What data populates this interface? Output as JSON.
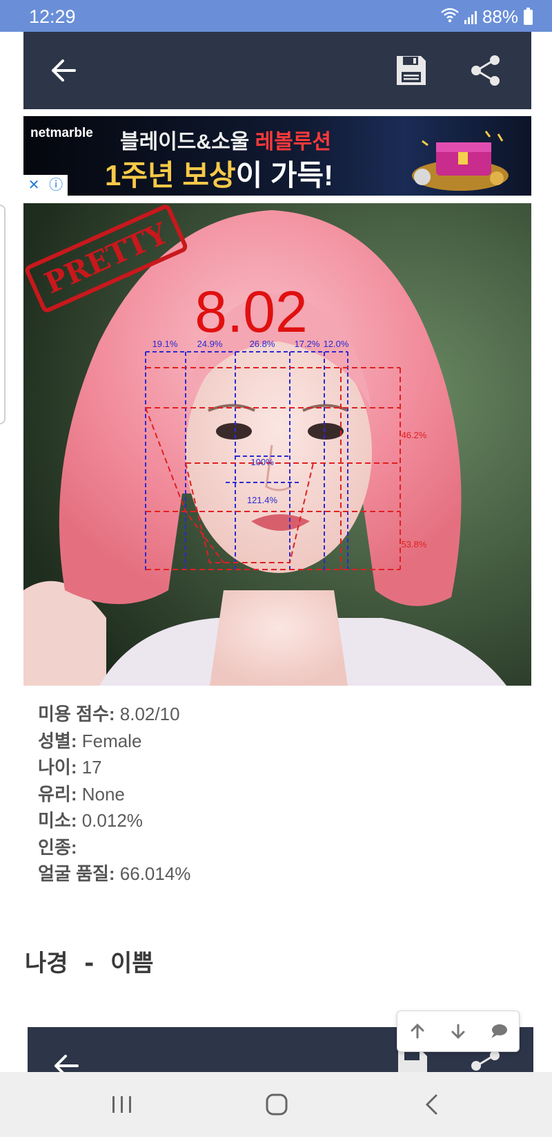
{
  "status": {
    "time": "12:29",
    "battery": "88%"
  },
  "toolbar": {
    "back": "arrow-left-icon",
    "save": "save-icon",
    "share": "share-icon"
  },
  "ad": {
    "brand": "netmarble",
    "line1_a": "블레이드&소울 ",
    "line1_b": "레볼루션",
    "line2_a": "1주년 ",
    "line2_b": "보상",
    "line2_c": "이 가득!",
    "close": "✕",
    "info": "ⓘ"
  },
  "analysis": {
    "stamp": "PRETTY",
    "score": "8.02",
    "width_ratios": [
      "19.1%",
      "24.9%",
      "26.8%",
      "17.2%",
      "12.0%"
    ],
    "nose_width": "100%",
    "mouth_width": "121.4%",
    "upper_ratio": "46.2%",
    "lower_ratio": "53.8%"
  },
  "info": [
    {
      "key": "미용 점수:",
      "value": " 8.02/10"
    },
    {
      "key": "성별:",
      "value": " Female"
    },
    {
      "key": "나이:",
      "value": " 17"
    },
    {
      "key": "유리:",
      "value": " None"
    },
    {
      "key": "미소:",
      "value": " 0.012%"
    },
    {
      "key": "인종:",
      "value": ""
    },
    {
      "key": "얼굴 품질:",
      "value": " 66.014%"
    }
  ],
  "title": "나경 - 이쁨",
  "floating": {
    "up": "arrow-up-icon",
    "down": "arrow-down-icon",
    "comment": "comment-icon"
  },
  "colors": {
    "statusbar": "#6a8fd8",
    "toolbar": "#2d3548",
    "score": "#e01010",
    "guides_red": "#e02020",
    "guides_blue": "#2020d0"
  }
}
